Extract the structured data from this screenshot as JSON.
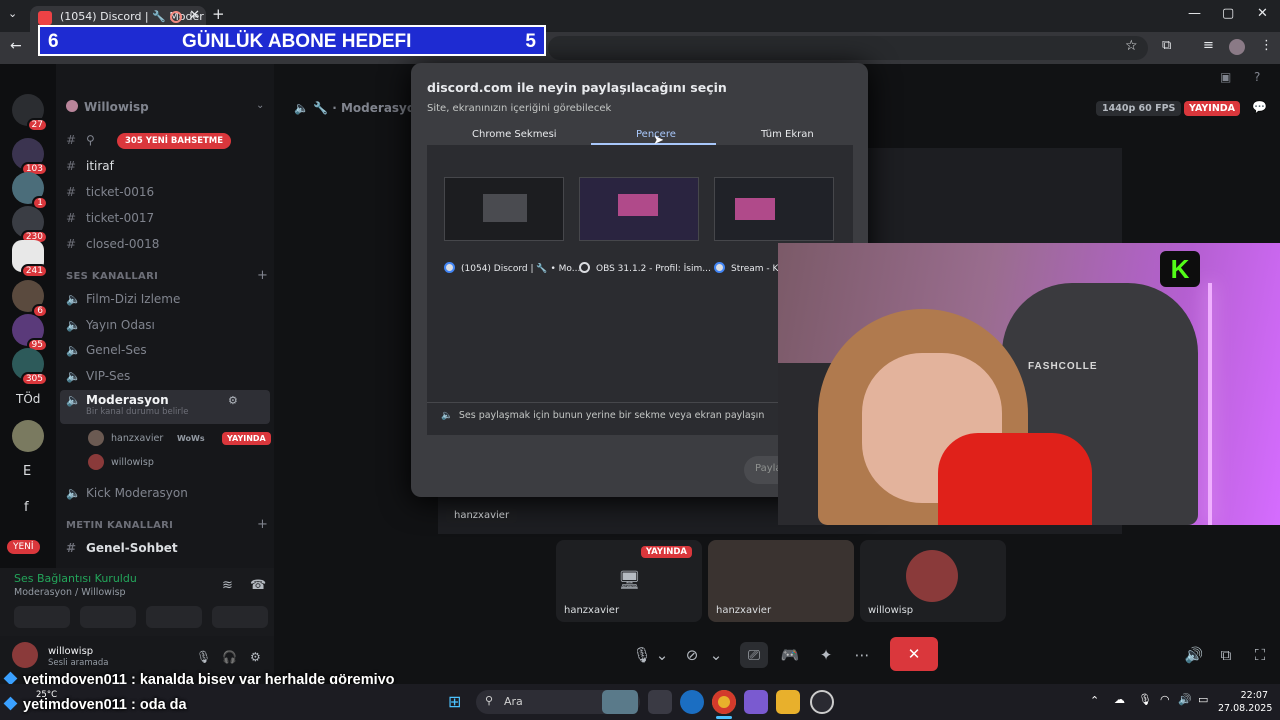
{
  "browser": {
    "tab_title": "(1054) Discord | 🔧 Moder",
    "new_tab": "+",
    "close": "✕",
    "minimize": "—",
    "maximize": "▢",
    "win_close": "✕"
  },
  "overlay_goal": {
    "current": "6",
    "title": "GÜNLÜK ABONE HEDEFI",
    "target": "5"
  },
  "server": {
    "name": "Willowisp",
    "badges": [
      "27",
      "103",
      "1",
      "230",
      "241",
      "6",
      "95",
      "305"
    ],
    "text_label": "TÖd",
    "letter1": "E",
    "letter2": "f",
    "new_badge": "YENİ"
  },
  "channels": {
    "new_mentions": "305 YENİ BAHSETME",
    "text_items": [
      "itiraf",
      "ticket-0016",
      "ticket-0017",
      "closed-0018"
    ],
    "voice_category": "SES KANALLARI",
    "voice_items": [
      "Film-Dizi Izleme",
      "Yayın Odası",
      "Genel-Ses",
      "VIP-Ses"
    ],
    "active_voice": "Moderasyon",
    "active_status": "Bir kanal durumu belirle",
    "members": [
      {
        "name": "hanzxavier",
        "tag": "WoWs",
        "live": "YAYINDA"
      },
      {
        "name": "willowisp"
      }
    ],
    "kick_channel": "Kick Moderasyon",
    "text_category": "METIN KANALLARI",
    "text_channel": "Genel-Sohbet"
  },
  "voice_panel": {
    "status": "Ses Bağlantısı Kuruldu",
    "location": "Moderasyon / Willowisp"
  },
  "user_panel": {
    "name": "willowisp",
    "status": "Sesli aramada"
  },
  "main": {
    "header_channel": "Moderasyon",
    "quality": "1440p 60 FPS",
    "live_badge": "YAYINDA",
    "stage_user": "hanzxavier",
    "tiles": [
      {
        "label": "hanzxavier",
        "live": "YAYINDA"
      },
      {
        "label": "hanzxavier"
      },
      {
        "label": "willowisp"
      }
    ]
  },
  "dialog": {
    "title": "discord.com ile neyin paylaşılacağını seçin",
    "subtitle": "Site, ekranınızın içeriğini görebilecek",
    "tabs": [
      "Chrome Sekmesi",
      "Pencere",
      "Tüm Ekran"
    ],
    "windows": [
      {
        "label": "(1054) Discord | 🔧 • Mo..."
      },
      {
        "label": "OBS 31.1.2 - Profil: İsim..."
      },
      {
        "label": "Stream - Ki"
      }
    ],
    "audio_note": "Ses paylaşmak için bunun yerine bir sekme veya ekran paylaşın",
    "share_button": "Payla"
  },
  "webcam": {
    "chair_brand": "FASHCOLLE",
    "logo_letter": "K"
  },
  "chat": [
    {
      "user": "yetimdoven011",
      "message": ": kanalda bişey var herhalde göremiyo"
    },
    {
      "user": "yetimdoven011",
      "message": ": oda da"
    }
  ],
  "taskbar": {
    "search_placeholder": "Ara",
    "weather": "25°C",
    "time": "22:07",
    "date": "27.08.2025"
  },
  "colors": {
    "goal_bg": "#1e2bd2",
    "live_red": "#da373c",
    "voice_green": "#23a55a",
    "accent_blue": "#a8c7fa"
  }
}
